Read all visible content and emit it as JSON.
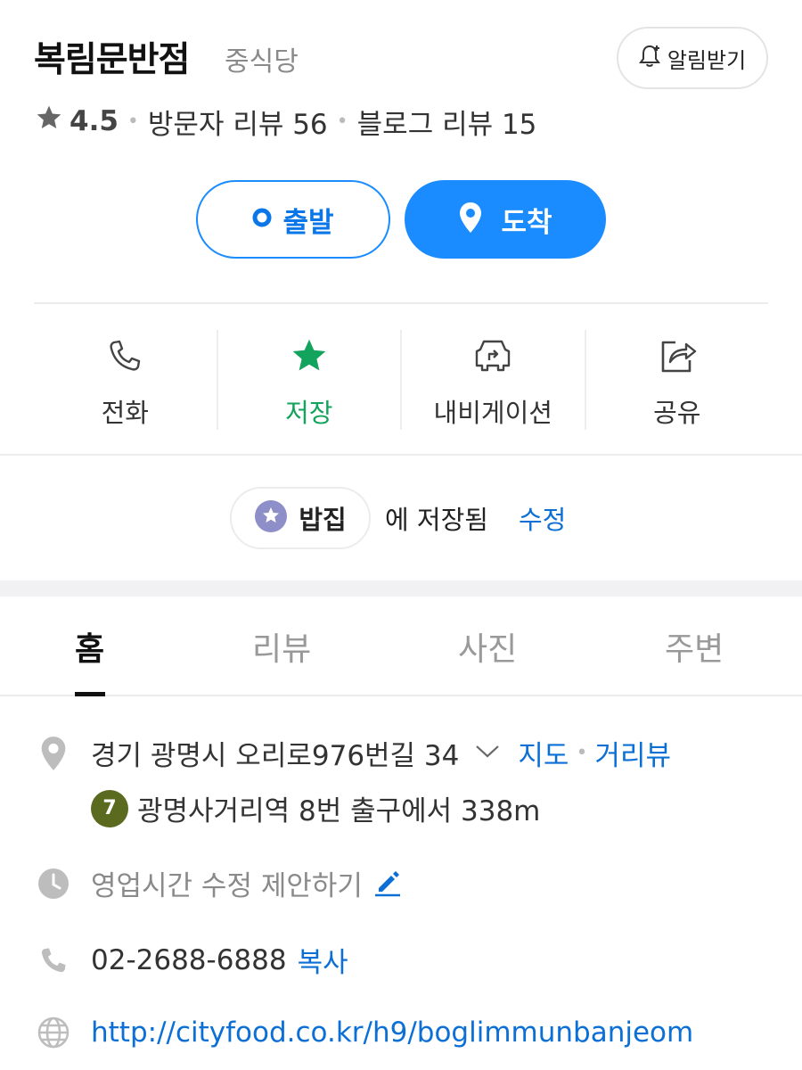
{
  "place": {
    "name": "복림문반점",
    "category": "중식당",
    "notify_label": "알림받기"
  },
  "rating": {
    "score": "4.5",
    "visitor_reviews": "방문자 리뷰 56",
    "blog_reviews": "블로그 리뷰 15"
  },
  "route": {
    "start_label": "출발",
    "arrive_label": "도착"
  },
  "actions": {
    "call": "전화",
    "save": "저장",
    "navigation": "내비게이션",
    "share": "공유"
  },
  "saved": {
    "folder": "밥집",
    "text": "에 저장됨",
    "edit": "수정"
  },
  "tabs": {
    "home": "홈",
    "review": "리뷰",
    "photo": "사진",
    "nearby": "주변"
  },
  "info": {
    "address": "경기 광명시 오리로976번길 34",
    "map_link": "지도",
    "roadview_link": "거리뷰",
    "subway_line": "7",
    "subway_text": "광명사거리역 8번 출구에서 338m",
    "hours_text": "영업시간 수정 제안하기",
    "phone": "02-2688-6888",
    "copy": "복사",
    "website": "http://cityfood.co.kr/h9/boglimmunbanjeom"
  },
  "colors": {
    "accent_blue": "#1a8cff",
    "link_blue": "#0b6fd6",
    "save_green": "#12a35c",
    "subway_line7": "#5a6b1f"
  }
}
